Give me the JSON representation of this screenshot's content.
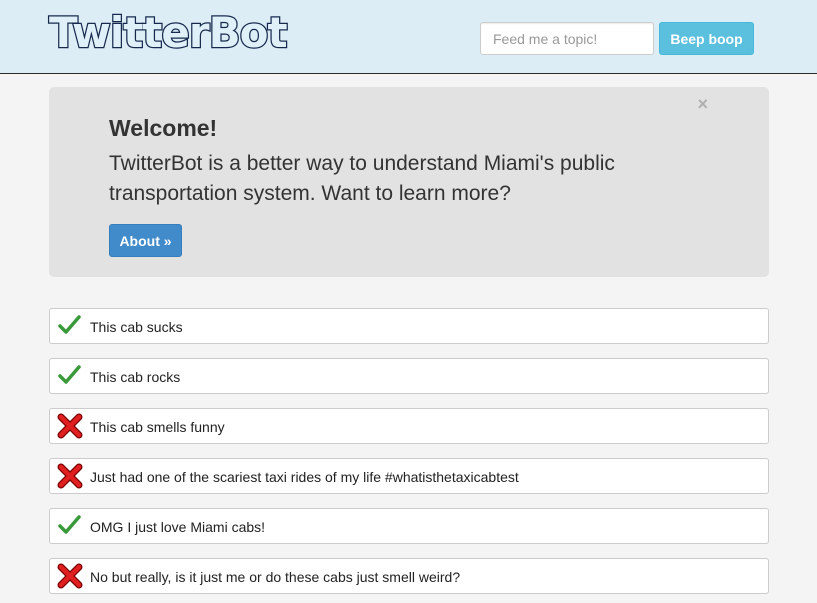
{
  "header": {
    "brand": "TwitterBot",
    "search_placeholder": "Feed me a topic!",
    "search_button": "Beep boop"
  },
  "hero": {
    "close": "×",
    "title": "Welcome!",
    "text": "TwitterBot is a better way to understand Miami's public transportation system. Want to learn more?",
    "button": "About »"
  },
  "colors": {
    "positive": "#3a9a3a",
    "negative": "#e02020",
    "primary": "#428bca",
    "info": "#5bc0de"
  },
  "tweets": [
    {
      "text": "This cab sucks",
      "status": "check-icon"
    },
    {
      "text": "This cab rocks",
      "status": "check-icon"
    },
    {
      "text": "This cab smells funny",
      "status": "cross-icon"
    },
    {
      "text": "Just had one of the scariest taxi rides of my life #whatisthetaxicabtest",
      "status": "cross-icon"
    },
    {
      "text": "OMG I just love Miami cabs!",
      "status": "check-icon"
    },
    {
      "text": "No but really, is it just me or do these cabs just smell weird?",
      "status": "cross-icon"
    }
  ]
}
